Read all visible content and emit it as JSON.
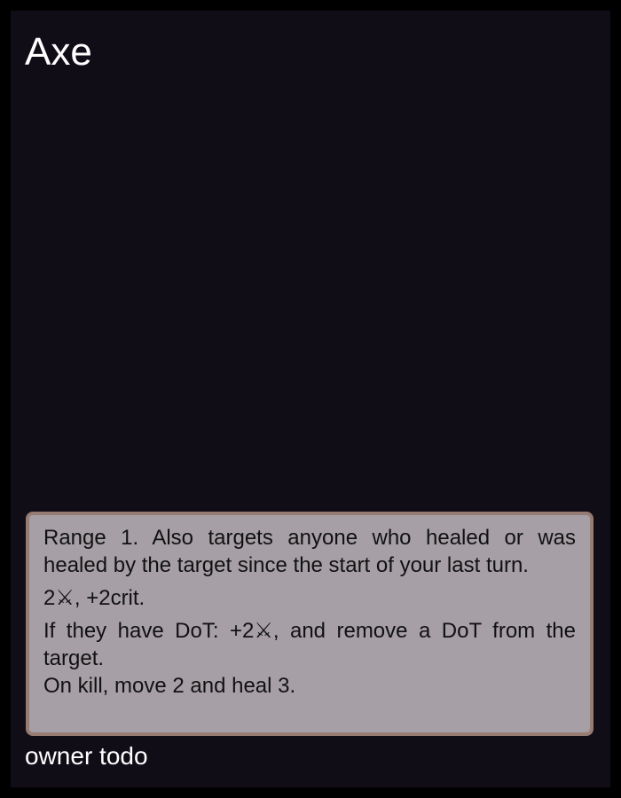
{
  "card": {
    "title": "Axe",
    "text": {
      "line1": "Range 1. Also targets anyone who healed or was healed by the target since the start of your last turn.",
      "line2": "2⚔, +2crit.",
      "line3": "If they have DoT: +2⚔, and remove a DoT from the target.",
      "line4": "On kill, move 2 and heal 3."
    },
    "owner": "owner todo"
  },
  "colors": {
    "page_background": "#000000",
    "card_background": "#110d17",
    "text_box_background": "#a69fa6",
    "text_box_border": "#977c73",
    "title_color": "#ffffff"
  }
}
